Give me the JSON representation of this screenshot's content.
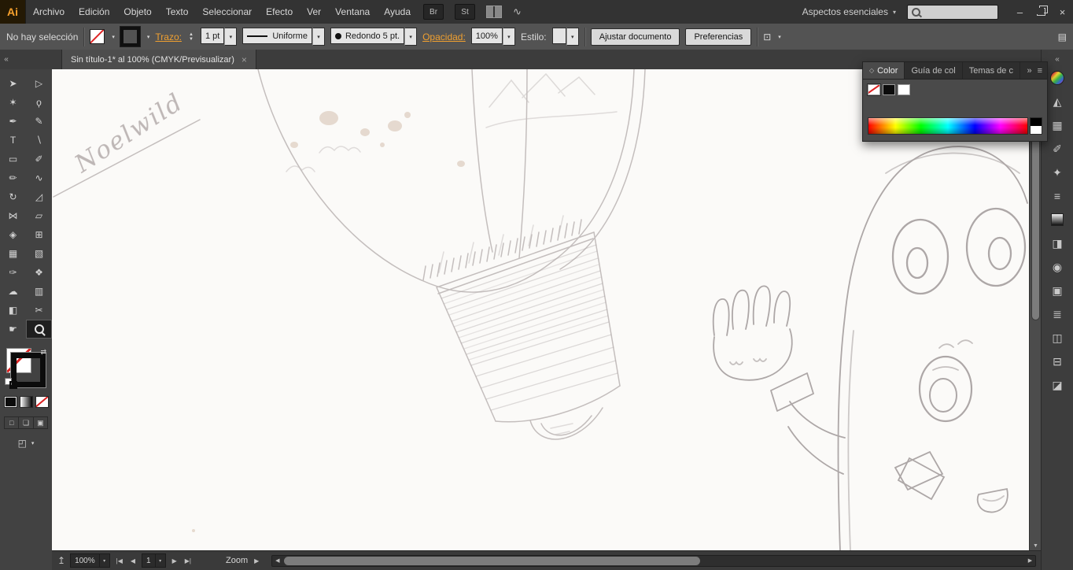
{
  "app": {
    "logo": "Ai",
    "workspace": "Aspectos esenciales"
  },
  "ui": {
    "caret": "▾",
    "stepper_up": "▲",
    "stepper_down": "▼",
    "up": "▲",
    "down": "▼",
    "left": "◀",
    "right": "▶",
    "first": "|◀",
    "last": "▶|",
    "collapse": "«",
    "expand": "»",
    "swap": "⇄",
    "menu": "▤",
    "panel_menu": "≡",
    "close": "×",
    "minimize": "–",
    "export": "↥",
    "diamond": "◇",
    "screen_mode": "◰",
    "draw_normal": "□",
    "draw_behind": "❏",
    "draw_inside": "▣"
  },
  "menubar": {
    "items": [
      "Archivo",
      "Edición",
      "Objeto",
      "Texto",
      "Seleccionar",
      "Efecto",
      "Ver",
      "Ventana",
      "Ayuda"
    ],
    "bridge": "Br",
    "stock": "St",
    "share_glyph": "∿"
  },
  "controlbar": {
    "selection_status": "No hay selección",
    "stroke_label": "Trazo:",
    "stroke_width": "1 pt",
    "profile": "Uniforme",
    "brush": "Redondo 5 pt.",
    "opacity_label": "Opacidad:",
    "opacity": "100%",
    "style_label": "Estilo:",
    "fit_document": "Ajustar documento",
    "preferences": "Preferencias",
    "libraries_glyph": "⊡"
  },
  "tabbar": {
    "title": "Sin título-1* al 100% (CMYK/Previsualizar)"
  },
  "tools": {
    "selection": {
      "glyph": "➤"
    },
    "direct_selection": {
      "glyph": "▷"
    },
    "magic_wand": {
      "glyph": "✶"
    },
    "lasso": {
      "glyph": "ϙ"
    },
    "pen": {
      "glyph": "✒"
    },
    "curvature": {
      "glyph": "✎"
    },
    "type": {
      "glyph": "T"
    },
    "line_segment": {
      "glyph": "∖"
    },
    "rectangle": {
      "glyph": "▭"
    },
    "paintbrush": {
      "glyph": "✐"
    },
    "pencil": {
      "glyph": "✏"
    },
    "shaper": {
      "glyph": "∿"
    },
    "rotate": {
      "glyph": "↻"
    },
    "scale": {
      "glyph": "◿"
    },
    "width": {
      "glyph": "⋈"
    },
    "free_transform": {
      "glyph": "▱"
    },
    "shape_builder": {
      "glyph": "◈"
    },
    "perspective_grid": {
      "glyph": "⊞"
    },
    "mesh": {
      "glyph": "▦"
    },
    "gradient": {
      "glyph": "▧"
    },
    "eyedropper": {
      "glyph": "✑"
    },
    "blend": {
      "glyph": "❖"
    },
    "symbol_sprayer": {
      "glyph": "☁"
    },
    "column_graph": {
      "glyph": "▥"
    },
    "artboard": {
      "glyph": "◧"
    },
    "slice": {
      "glyph": "✂"
    },
    "hand": {
      "glyph": "☛"
    }
  },
  "color_panel": {
    "tab_color": "Color",
    "tab_color_guide": "Guía de col",
    "tab_themes": "Temas de c"
  },
  "dock": {
    "color_guide": {
      "glyph": "◭"
    },
    "swatches": {
      "glyph": "▦"
    },
    "brushes": {
      "glyph": "✐"
    },
    "symbols": {
      "glyph": "✦"
    },
    "stroke": {
      "glyph": "≡"
    },
    "transparency": {
      "glyph": "◨"
    },
    "appearance": {
      "glyph": "◉"
    },
    "graphic_styles": {
      "glyph": "▣"
    },
    "layers": {
      "glyph": "≣"
    },
    "artboards": {
      "glyph": "◫"
    },
    "align": {
      "glyph": "⊟"
    },
    "pathfinder": {
      "glyph": "◪"
    }
  },
  "statusbar": {
    "zoom": "100%",
    "artboard": "1",
    "tool_status": "Zoom"
  },
  "canvas": {
    "signature": "Noelwild"
  }
}
